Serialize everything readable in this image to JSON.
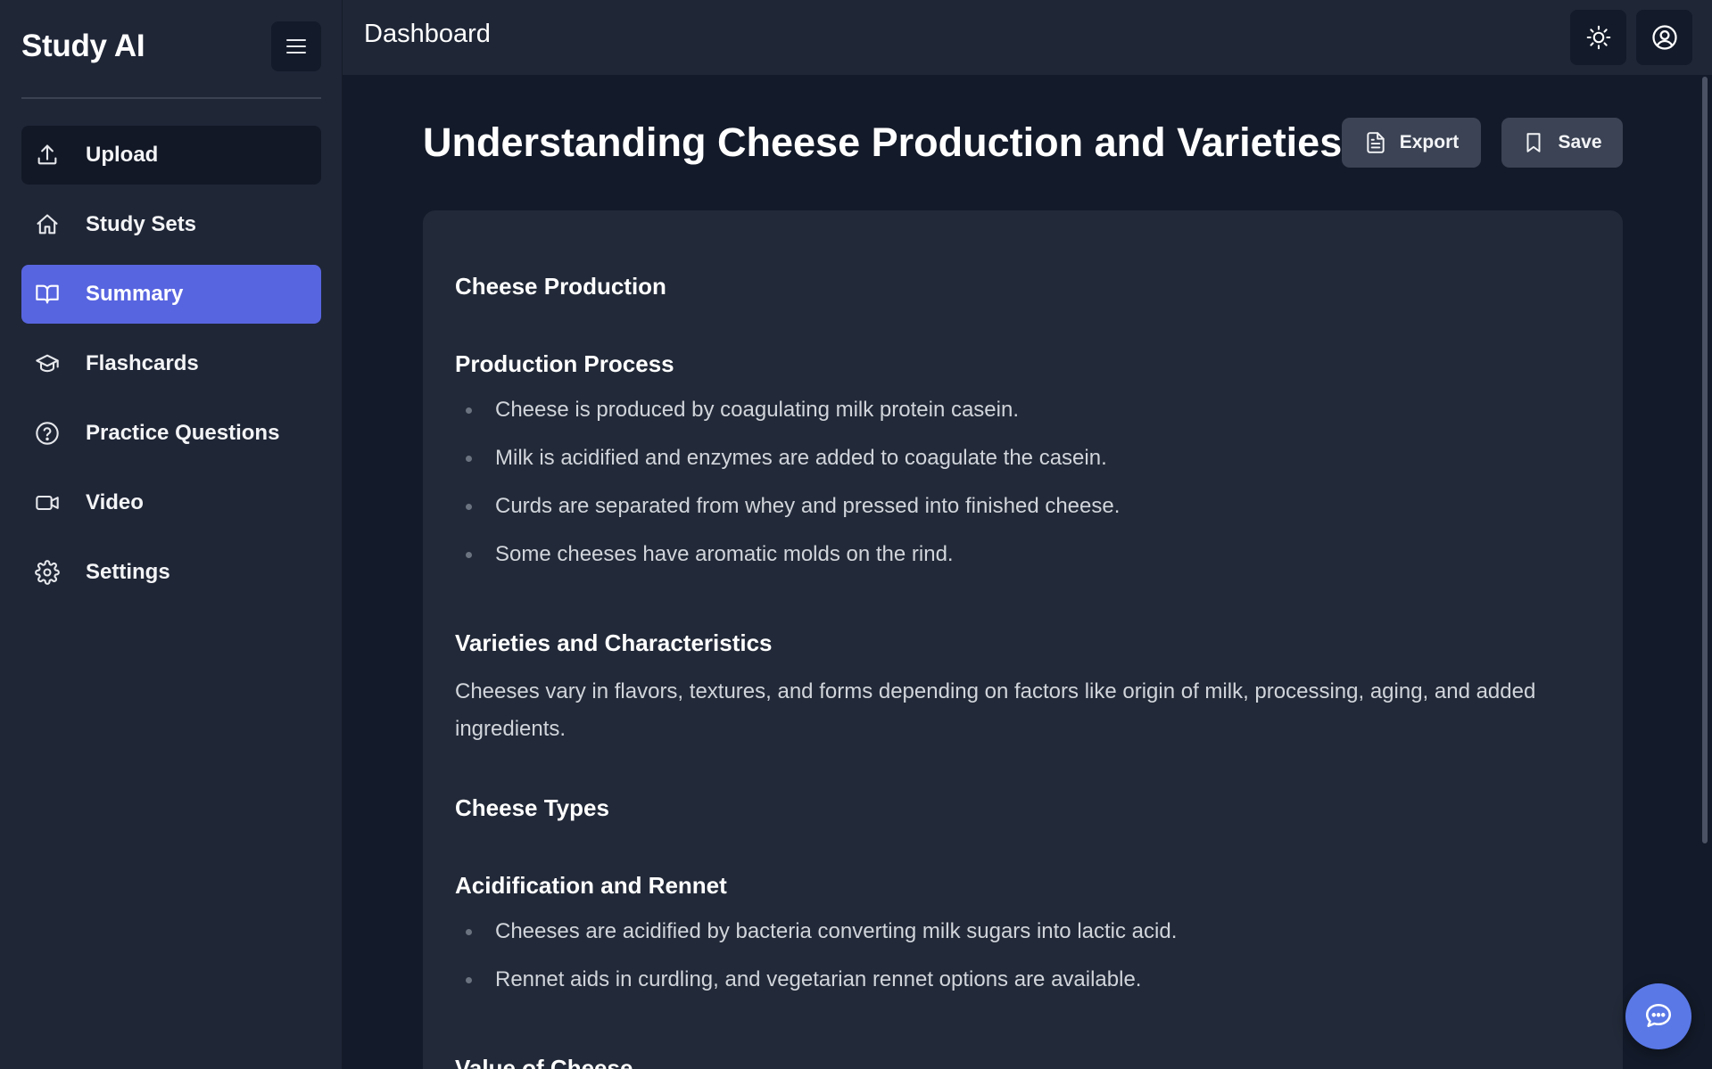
{
  "sidebar": {
    "brand": "Study AI",
    "items": [
      {
        "label": "Upload",
        "icon": "upload-icon"
      },
      {
        "label": "Study Sets",
        "icon": "home-icon"
      },
      {
        "label": "Summary",
        "icon": "book-open-icon"
      },
      {
        "label": "Flashcards",
        "icon": "graduation-cap-icon"
      },
      {
        "label": "Practice Questions",
        "icon": "help-circle-icon"
      },
      {
        "label": "Video",
        "icon": "video-icon"
      },
      {
        "label": "Settings",
        "icon": "gear-icon"
      }
    ],
    "active_item": "Summary"
  },
  "header": {
    "title": "Dashboard",
    "theme_icon": "sun-icon",
    "account_icon": "user-circle-icon"
  },
  "main": {
    "title": "Understanding Cheese Production and Varieties",
    "export_label": "Export",
    "save_label": "Save",
    "summary": {
      "section1": {
        "title": "Cheese Production",
        "production_process": {
          "heading": "Production Process",
          "bullets": [
            "Cheese is produced by coagulating milk protein casein.",
            "Milk is acidified and enzymes are added to coagulate the casein.",
            "Curds are separated from whey and pressed into finished cheese.",
            "Some cheeses have aromatic molds on the rind."
          ]
        },
        "varieties": {
          "heading": "Varieties and Characteristics",
          "text": "Cheeses vary in flavors, textures, and forms depending on factors like origin of milk, processing, aging, and added ingredients."
        }
      },
      "section2": {
        "title": "Cheese Types",
        "acidification": {
          "heading": "Acidification and Rennet",
          "bullets": [
            "Cheeses are acidified by bacteria converting milk sugars into lactic acid.",
            "Rennet aids in curdling, and vegetarian rennet options are available."
          ]
        },
        "value_heading": "Value of Cheese"
      }
    }
  },
  "colors": {
    "accent": "#5865e0",
    "sidebar_bg": "#1f2636",
    "page_bg": "#131a29",
    "card_bg": "#222938",
    "chat_button": "#5a78e6"
  },
  "chat_icon": "chat-bubble-icon"
}
